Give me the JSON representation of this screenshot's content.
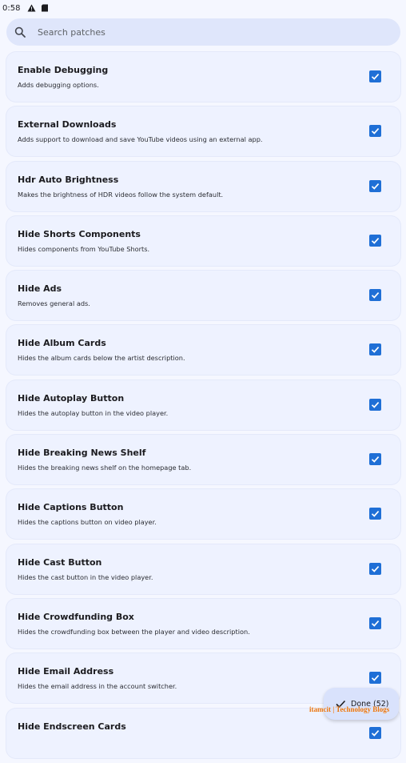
{
  "status_bar": {
    "time": "0:58",
    "icons": [
      "warning-icon",
      "sd-card-icon"
    ]
  },
  "search": {
    "placeholder": "Search patches"
  },
  "patches": [
    {
      "title": "Enable Debugging",
      "description": "Adds debugging options.",
      "checked": true
    },
    {
      "title": "External Downloads",
      "description": "Adds support to download and save YouTube videos using an external app.",
      "checked": true
    },
    {
      "title": "Hdr Auto Brightness",
      "description": "Makes the brightness of HDR videos follow the system default.",
      "checked": true
    },
    {
      "title": "Hide Shorts Components",
      "description": "Hides components from YouTube Shorts.",
      "checked": true
    },
    {
      "title": "Hide Ads",
      "description": "Removes general ads.",
      "checked": true
    },
    {
      "title": "Hide Album Cards",
      "description": "Hides the album cards below the artist description.",
      "checked": true
    },
    {
      "title": "Hide Autoplay Button",
      "description": "Hides the autoplay button in the video player.",
      "checked": true
    },
    {
      "title": "Hide Breaking News Shelf",
      "description": "Hides the breaking news shelf on the homepage tab.",
      "checked": true
    },
    {
      "title": "Hide Captions Button",
      "description": "Hides the captions button on video player.",
      "checked": true
    },
    {
      "title": "Hide Cast Button",
      "description": "Hides the cast button in the video player.",
      "checked": true
    },
    {
      "title": "Hide Crowdfunding Box",
      "description": "Hides the crowdfunding box between the player and video description.",
      "checked": true
    },
    {
      "title": "Hide Email Address",
      "description": "Hides the email address in the account switcher.",
      "checked": true
    },
    {
      "title": "Hide Endscreen Cards",
      "description": "",
      "checked": true
    }
  ],
  "fab": {
    "label": "Done (52)",
    "icon": "check-icon"
  },
  "watermark": "itamcit | Technology Blogs",
  "colors": {
    "accent": "#1f6fd6",
    "background": "#f5f7ff",
    "card": "#eef2ff",
    "search_bg": "#dfe6fb",
    "fab_bg": "#d9e2fc",
    "watermark": "#e8720c"
  }
}
